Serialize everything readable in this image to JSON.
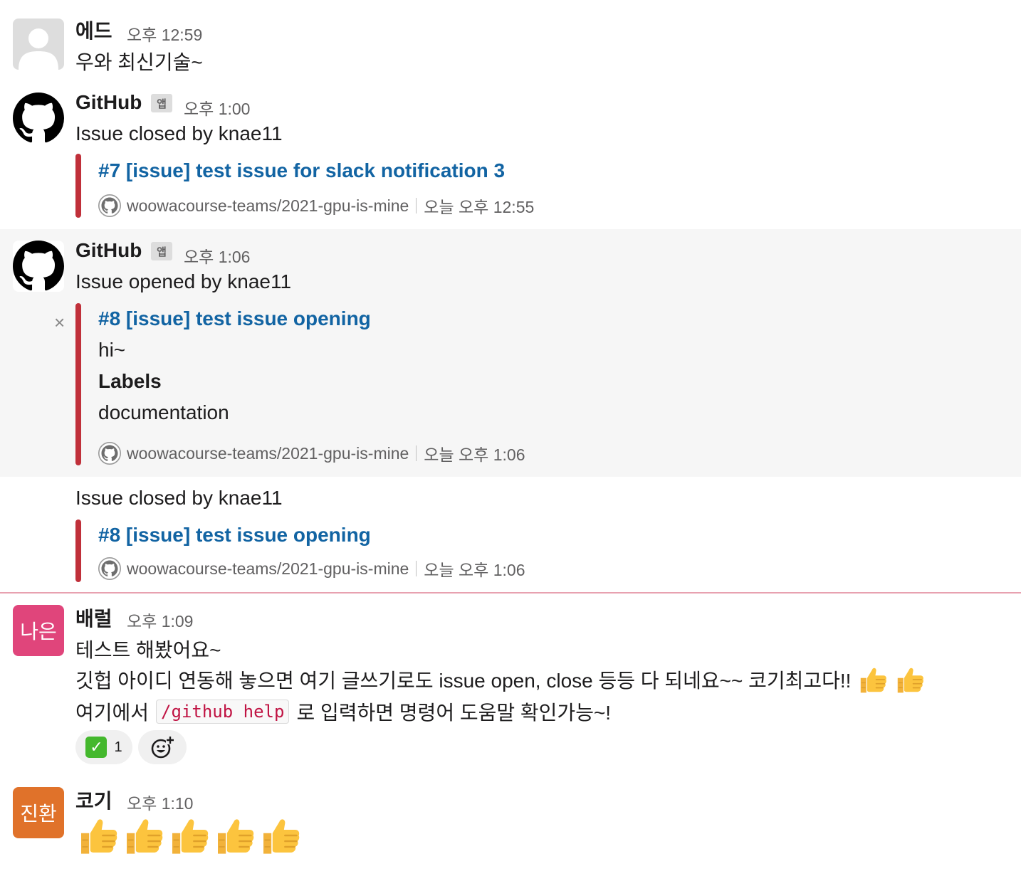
{
  "messages": [
    {
      "name": "에드",
      "time": "오후 12:59",
      "text": "우와 최신기술~"
    },
    {
      "name": "GitHub",
      "app_badge": "앱",
      "time": "오후 1:00",
      "text": "Issue closed by knae11",
      "attachment": {
        "title": "#7 [issue] test issue for slack notification 3",
        "repo": "woowacourse-teams/2021-gpu-is-mine",
        "timestamp": "오늘 오후 12:55"
      }
    },
    {
      "name": "GitHub",
      "app_badge": "앱",
      "time": "오후 1:06",
      "text": "Issue opened by knae11",
      "close_label": "×",
      "attachment": {
        "title": "#8 [issue] test issue opening",
        "body": "hi~",
        "labels_heading": "Labels",
        "labels_value": "documentation",
        "repo": "woowacourse-teams/2021-gpu-is-mine",
        "timestamp": "오늘 오후 1:06"
      }
    },
    {
      "text": "Issue closed by knae11",
      "attachment": {
        "title": "#8 [issue] test issue opening",
        "repo": "woowacourse-teams/2021-gpu-is-mine",
        "timestamp": "오늘 오후 1:06"
      }
    },
    {
      "avatar_text": "나은",
      "avatar_color": "#e0457b",
      "name": "배럴",
      "time": "오후 1:09",
      "line1": "테스트 해봤어요~",
      "line2": "깃헙 아이디 연동해 놓으면 여기 글쓰기로도 issue open, close 등등 다 되네요~~ 코기최고다!!",
      "line3_before": "여기에서",
      "line3_code": "/github help",
      "line3_after": "로 입력하면 명령어 도움말 확인가능~!",
      "reaction_count": "1",
      "reaction_emoji": "white-check-mark",
      "add_reaction_icon": "add-reaction-icon"
    },
    {
      "avatar_text": "진환",
      "avatar_color": "#e0722a",
      "name": "코기",
      "time": "오후 1:10",
      "emoji_count": "5",
      "emoji": "thumbs-up"
    }
  ],
  "colors": {
    "link": "#1264a3",
    "attachment_bar": "#c0303a",
    "new_divider": "#e8a1b0",
    "code": "#c01343",
    "highlight_bg": "#f6f6f6"
  }
}
